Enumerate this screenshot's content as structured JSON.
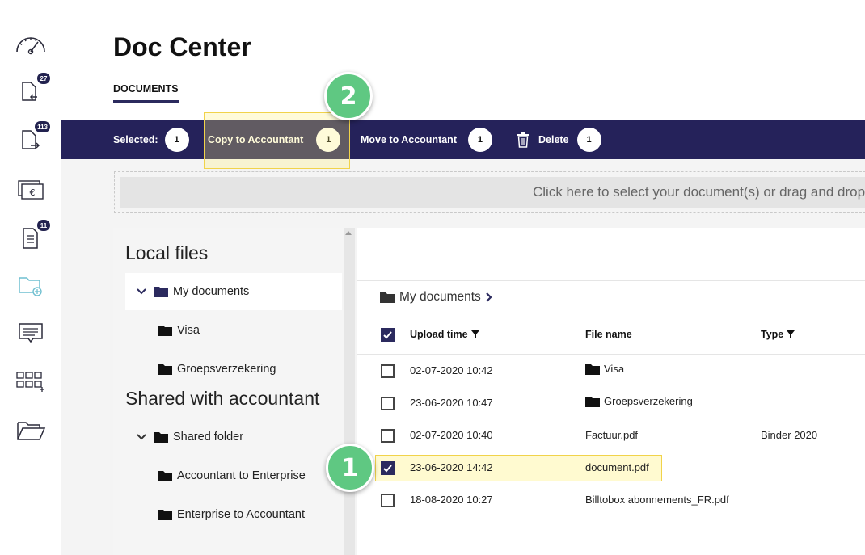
{
  "sidebar": {
    "items": [
      {
        "icon": "dashboard-gauge-icon",
        "badge": ""
      },
      {
        "icon": "incoming-documents-icon",
        "badge": "27"
      },
      {
        "icon": "outgoing-documents-icon",
        "badge": "113"
      },
      {
        "icon": "euro-payments-icon",
        "badge": ""
      },
      {
        "icon": "document-list-icon",
        "badge": "11"
      },
      {
        "icon": "add-folder-icon",
        "badge": ""
      },
      {
        "icon": "messages-icon",
        "badge": ""
      },
      {
        "icon": "apps-grid-icon",
        "badge": ""
      },
      {
        "icon": "open-folder-icon",
        "badge": ""
      }
    ]
  },
  "page": {
    "title": "Doc Center",
    "tab": "DOCUMENTS"
  },
  "action_bar": {
    "selected_label": "Selected:",
    "selected_count": "1",
    "copy_label": "Copy to Accountant",
    "copy_count": "1",
    "move_label": "Move to Accountant",
    "move_count": "1",
    "delete_label": "Delete",
    "delete_count": "1"
  },
  "dropzone": {
    "text": "Click here to select your document(s) or drag and drop"
  },
  "tree": {
    "local_title": "Local files",
    "local_items": [
      {
        "label": "My documents"
      },
      {
        "label": "Visa"
      },
      {
        "label": "Groepsverzekering"
      }
    ],
    "shared_title": "Shared with accountant",
    "shared_items": [
      {
        "label": "Shared folder"
      },
      {
        "label": "Accountant to Enterprise"
      },
      {
        "label": "Enterprise to Accountant"
      }
    ]
  },
  "file_list": {
    "breadcrumb": "My documents",
    "columns": {
      "upload_time": "Upload time",
      "file_name": "File name",
      "type": "Type"
    },
    "rows": [
      {
        "upload_time": "02-07-2020 10:42",
        "file_name": "Visa",
        "type": ""
      },
      {
        "upload_time": "23-06-2020 10:47",
        "file_name": "Groepsverzekering",
        "type": ""
      },
      {
        "upload_time": "02-07-2020 10:40",
        "file_name": "Factuur.pdf",
        "type": "Binder 2020"
      },
      {
        "upload_time": "23-06-2020 14:42",
        "file_name": "document.pdf",
        "type": ""
      },
      {
        "upload_time": "18-08-2020 10:27",
        "file_name": "Billtobox abonnements_FR.pdf",
        "type": ""
      }
    ]
  },
  "callouts": {
    "step1": "1",
    "step2": "2"
  },
  "colors": {
    "navy": "#25225a",
    "callout_green": "#5fc882",
    "highlight_yellow": "#f1d34a"
  }
}
